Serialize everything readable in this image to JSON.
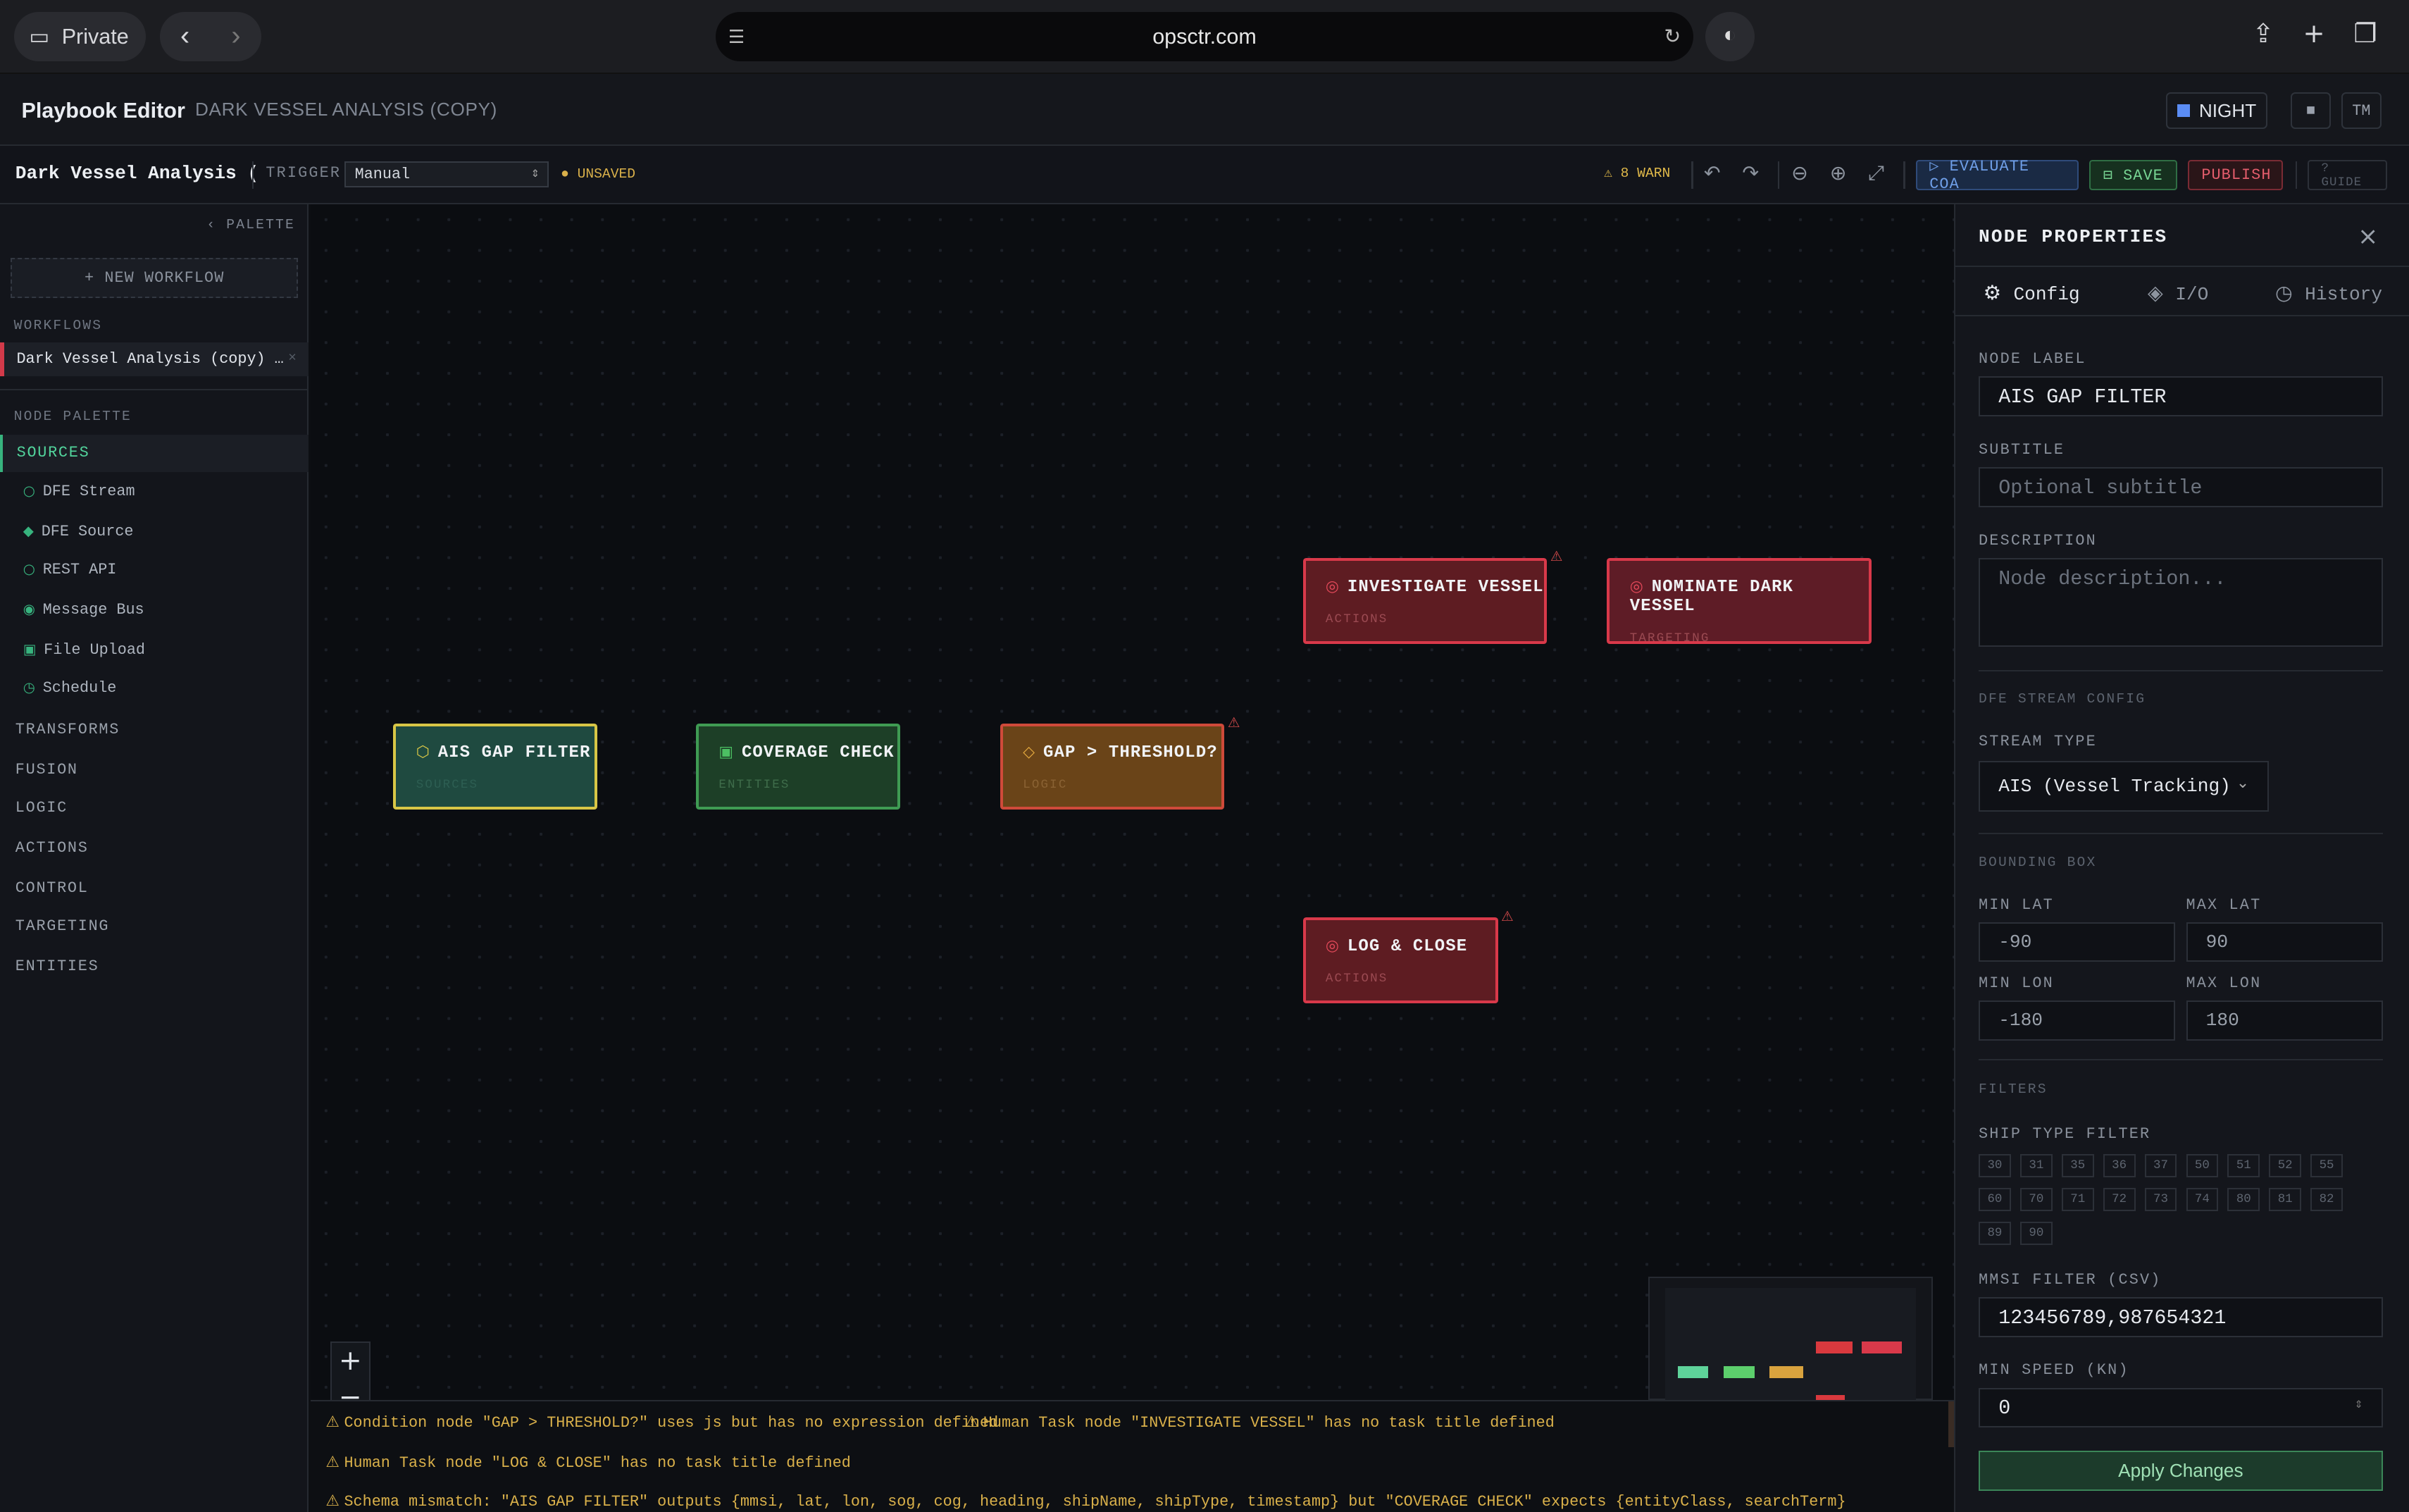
{
  "browser": {
    "private_label": "Private",
    "url": "opsctr.com"
  },
  "app": {
    "title": "Playbook Editor",
    "subtitle": "DARK VESSEL ANALYSIS (COPY)",
    "night_label": "NIGHT",
    "user_initials": "TM"
  },
  "toolbar": {
    "workflow_name": "Dark Vessel Analysis (",
    "trigger_label": "TRIGGER",
    "trigger_value": "Manual",
    "unsaved_label": "● UNSAVED",
    "warn_label": "⚠ 8 WARN",
    "evaluate_label": "▷ EVALUATE COA",
    "save_label": "⊟ SAVE",
    "publish_label": "PUBLISH",
    "guide_label": "? GUIDE"
  },
  "sidebar": {
    "palette_toggle": "‹  PALETTE",
    "new_workflow": "+ NEW WORKFLOW",
    "workflows_heading": "WORKFLOWS",
    "workflow_item": "Dark Vessel Analysis (copy) …",
    "node_palette_heading": "NODE PALETTE",
    "categories": [
      "SOURCES",
      "TRANSFORMS",
      "FUSION",
      "LOGIC",
      "ACTIONS",
      "CONTROL",
      "TARGETING",
      "ENTITIES"
    ],
    "source_items": [
      "DFE Stream",
      "DFE Source",
      "REST API",
      "Message Bus",
      "File Upload",
      "Schedule"
    ]
  },
  "canvas": {
    "nodes": [
      {
        "title": "AIS GAP FILTER",
        "category": "SOURCES"
      },
      {
        "title": "COVERAGE CHECK",
        "category": "ENTITIES"
      },
      {
        "title": "GAP > THRESHOLD?",
        "category": "LOGIC"
      },
      {
        "title": "INVESTIGATE VESSEL",
        "category": "ACTIONS"
      },
      {
        "title": "NOMINATE DARK VESSEL",
        "category": "TARGETING"
      },
      {
        "title": "LOG & CLOSE",
        "category": "ACTIONS"
      }
    ],
    "zoom_in": "+",
    "zoom_out": "−"
  },
  "warnings": [
    "Condition node \"GAP > THRESHOLD?\" uses js but has no expression defined",
    "Human Task node \"INVESTIGATE VESSEL\" has no task title defined",
    "Human Task node \"LOG & CLOSE\" has no task title defined",
    "Schema mismatch: \"AIS GAP FILTER\" outputs {mmsi, lat, lon, sog, cog, heading, shipName, shipType, timestamp} but \"COVERAGE CHECK\" expects {entityClass, searchTerm}"
  ],
  "panel": {
    "title": "NODE PROPERTIES",
    "tabs": [
      "Config",
      "I/O",
      "History"
    ],
    "node_label_heading": "NODE LABEL",
    "node_label_value": "AIS GAP FILTER",
    "subtitle_heading": "SUBTITLE",
    "subtitle_placeholder": "Optional subtitle",
    "description_heading": "DESCRIPTION",
    "description_placeholder": "Node description...",
    "stream_config_heading": "DFE STREAM CONFIG",
    "stream_type_heading": "STREAM TYPE",
    "stream_type_value": "AIS (Vessel Tracking)",
    "bbox_heading": "BOUNDING BOX",
    "min_lat_label": "MIN LAT",
    "max_lat_label": "MAX LAT",
    "min_lon_label": "MIN LON",
    "max_lon_label": "MAX LON",
    "min_lat": "-90",
    "max_lat": "90",
    "min_lon": "-180",
    "max_lon": "180",
    "filters_heading": "FILTERS",
    "ship_type_heading": "SHIP TYPE FILTER",
    "ship_types": [
      "30",
      "31",
      "35",
      "36",
      "37",
      "50",
      "51",
      "52",
      "55",
      "60",
      "70",
      "71",
      "72",
      "73",
      "74",
      "80",
      "81",
      "82",
      "89",
      "90"
    ],
    "mmsi_heading": "MMSI FILTER (CSV)",
    "mmsi_value": "123456789,987654321",
    "min_speed_heading": "MIN SPEED (KN)",
    "min_speed_value": "0",
    "apply_label": "Apply Changes"
  },
  "colors": {
    "accent_green": "#37b37e",
    "danger_red": "#d9394a",
    "warning_amber": "#d9b04a",
    "info_blue": "#5b8df5"
  }
}
